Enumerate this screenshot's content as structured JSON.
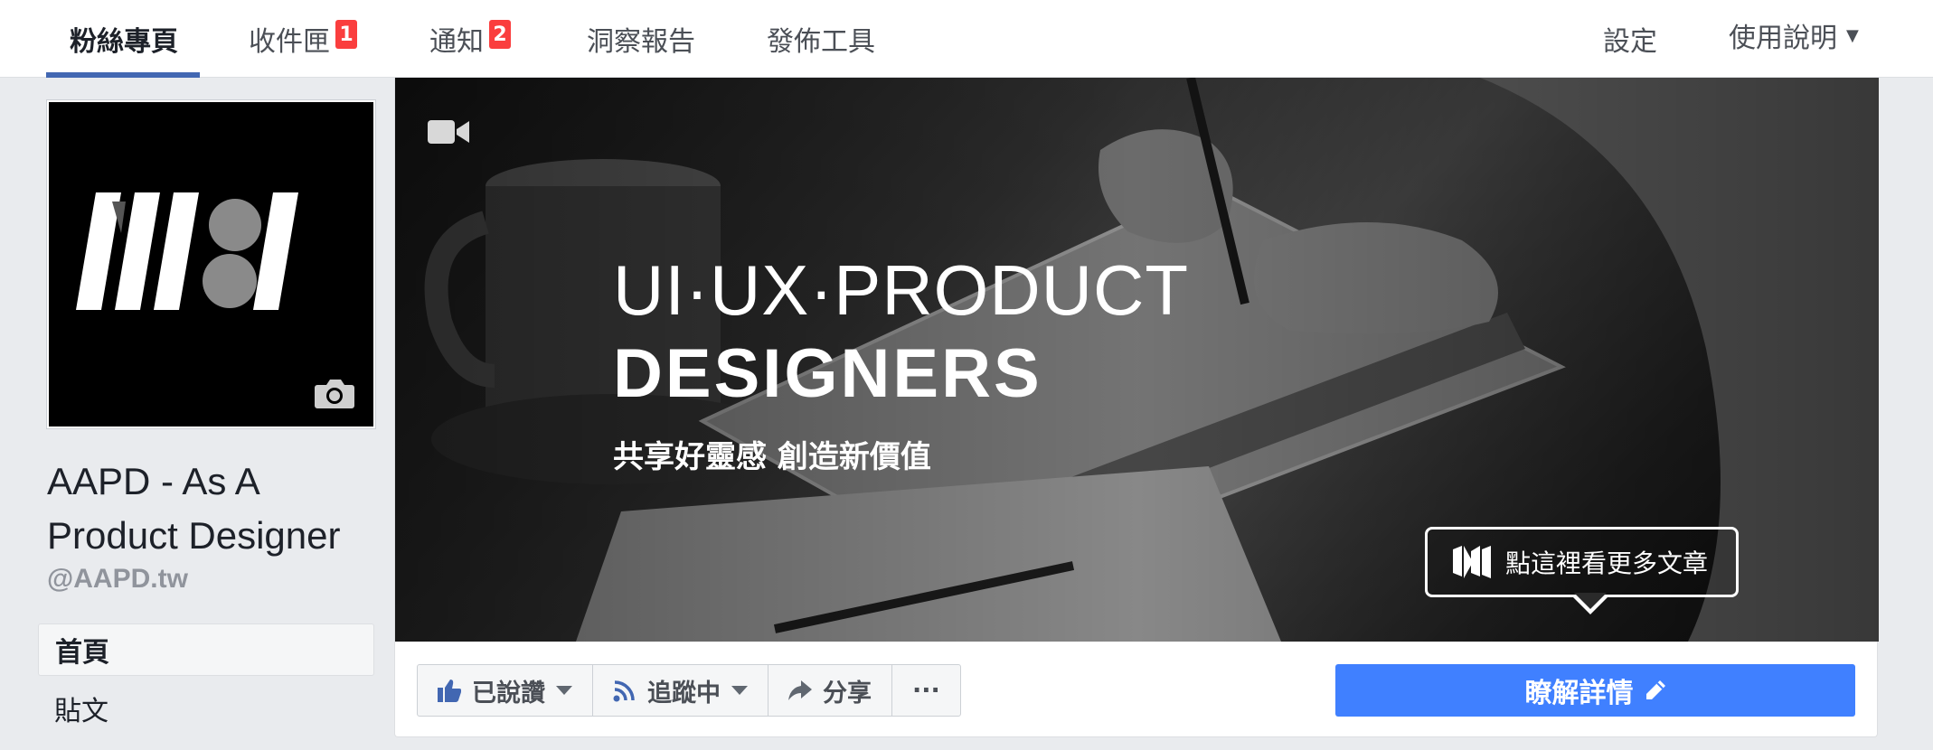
{
  "tabs": [
    {
      "label": "粉絲專頁",
      "active": true
    },
    {
      "label": "收件匣",
      "badge": "1"
    },
    {
      "label": "通知",
      "badge": "2"
    },
    {
      "label": "洞察報告"
    },
    {
      "label": "發佈工具"
    }
  ],
  "right_tabs": {
    "settings": "設定",
    "help": "使用說明"
  },
  "page": {
    "name_line1": "AAPD - As A",
    "name_line2": "Product Designer",
    "handle": "@AAPD.tw"
  },
  "nav": [
    {
      "label": "首頁",
      "active": true
    },
    {
      "label": "貼文"
    }
  ],
  "cover": {
    "title_line1": "UI·UX·PRODUCT",
    "title_line2": "DESIGNERS",
    "tagline": "共享好靈感 創造新價值",
    "cta": "點這裡看更多文章"
  },
  "actions": {
    "liked": "已說讚",
    "following": "追蹤中",
    "share": "分享",
    "more": "···"
  },
  "learn_more": "瞭解詳情",
  "colors": {
    "brand_blue": "#4267b2",
    "cta_blue": "#4080ff",
    "badge_red": "#fa3e3e"
  },
  "icons": [
    "video-camera-icon",
    "camera-icon",
    "medium-logo-icon",
    "thumbs-up-icon",
    "rss-icon",
    "share-arrow-icon",
    "pencil-icon",
    "chevron-down-icon"
  ]
}
